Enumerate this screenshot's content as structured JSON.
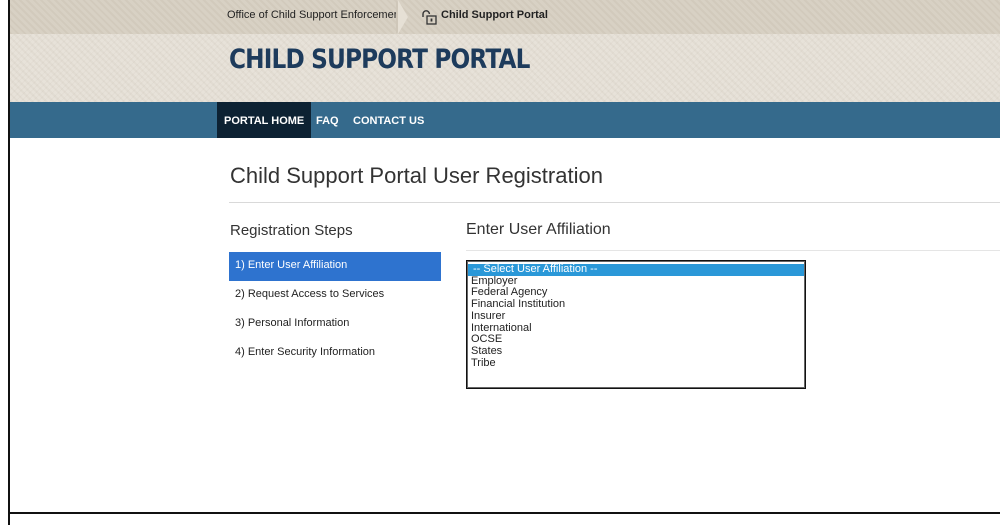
{
  "breadcrumb": {
    "root": "Office of Child Support Enforcement",
    "current": "Child Support Portal"
  },
  "site": {
    "title": "CHILD SUPPORT PORTAL"
  },
  "nav": {
    "items": [
      {
        "label": "PORTAL HOME",
        "active": true
      },
      {
        "label": "FAQ",
        "active": false
      },
      {
        "label": "CONTACT US",
        "active": false
      }
    ]
  },
  "page": {
    "title": "Child Support Portal User Registration"
  },
  "steps": {
    "heading": "Registration Steps",
    "items": [
      {
        "label": "1) Enter User Affiliation",
        "active": true
      },
      {
        "label": "2) Request Access to Services",
        "active": false
      },
      {
        "label": "3) Personal Information",
        "active": false
      },
      {
        "label": "4) Enter Security Information",
        "active": false
      }
    ]
  },
  "affiliation": {
    "heading": "Enter User Affiliation",
    "selected": "-- Select User Affiliation --",
    "options": [
      "-- Select User Affiliation --",
      "Employer",
      "Federal Agency",
      "Financial Institution",
      "Insurer",
      "International",
      "OCSE",
      "States",
      "Tribe"
    ]
  },
  "colors": {
    "nav_bg": "#356a8c",
    "nav_active_bg": "#0d2233",
    "title_color": "#1d3b5c",
    "step_active_bg": "#2e73cf",
    "option_selected_bg": "#2a98d8"
  }
}
